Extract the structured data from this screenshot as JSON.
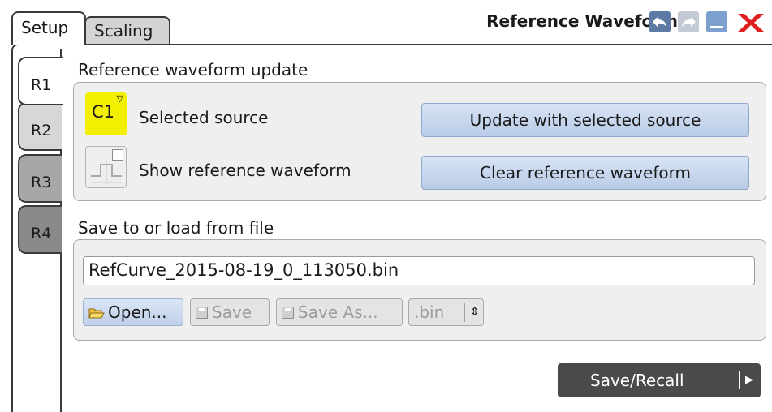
{
  "tabs": {
    "setup": "Setup",
    "scaling": "Scaling"
  },
  "dialog": {
    "title": "Reference Waveform"
  },
  "side_tabs": [
    "R1",
    "R2",
    "R3",
    "R4"
  ],
  "update_section": {
    "heading": "Reference waveform update",
    "source_chip": "C1",
    "selected_source_label": "Selected source",
    "show_label": "Show reference waveform",
    "update_button": "Update with selected source",
    "clear_button": "Clear reference waveform"
  },
  "file_section": {
    "heading": "Save to or load from file",
    "file_path": "RefCurve_2015-08-19_0_113050.bin",
    "open_button": "Open...",
    "save_button": "Save",
    "save_as_button": "Save As...",
    "extension": ".bin"
  },
  "footer": {
    "save_recall_button": "Save/Recall"
  },
  "colors": {
    "source_chip": "#f2f000",
    "button_blue": "#c5d5ed",
    "close_red": "#e02020"
  }
}
